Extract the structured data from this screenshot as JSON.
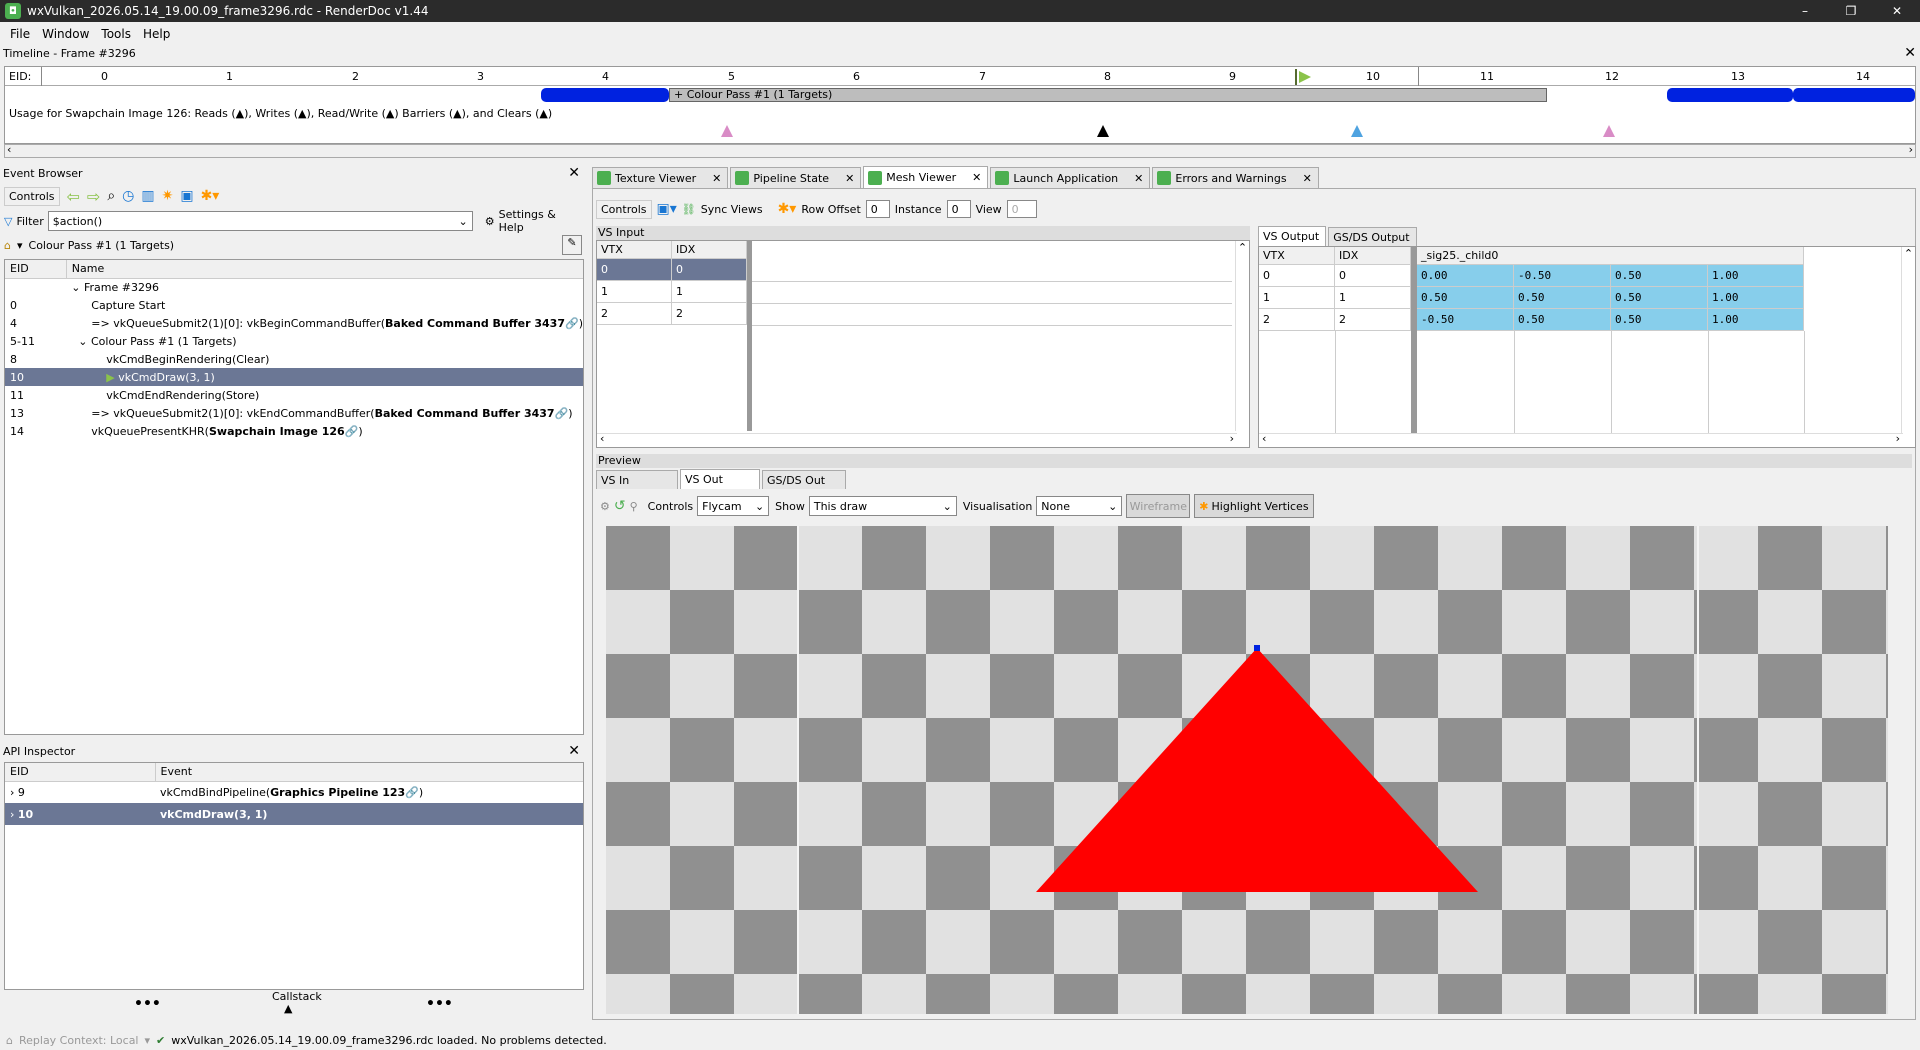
{
  "window": {
    "title": "wxVulkan_2026.05.14_19.00.09_frame3296.rdc - RenderDoc v1.44",
    "min": "–",
    "restore": "❐",
    "close": "✕"
  },
  "menu": [
    "File",
    "Window",
    "Tools",
    "Help"
  ],
  "timeline": {
    "title": "Timeline - Frame #3296",
    "eid_label": "EID:",
    "ticks": [
      "0",
      "1",
      "2",
      "3",
      "4",
      "5",
      "6",
      "7",
      "8",
      "9",
      "10",
      "11",
      "12",
      "13",
      "14"
    ],
    "pass_label": "+ Colour Pass #1 (1 Targets)",
    "usage_text": "Usage for Swapchain Image 126: Reads (▲), Writes (▲), Read/Write (▲) Barriers (▲), and Clears (▲)"
  },
  "event_browser": {
    "title": "Event Browser",
    "controls_label": "Controls",
    "filter_label": "Filter",
    "filter_value": "$action()",
    "settings_label": "Settings & Help",
    "breadcrumb": "Colour Pass #1 (1 Targets)",
    "columns": [
      "EID",
      "Name"
    ],
    "rows": [
      {
        "eid": "",
        "name": "Frame #3296",
        "indent": 0,
        "expand": "v"
      },
      {
        "eid": "0",
        "name": "Capture Start",
        "indent": 1
      },
      {
        "eid": "4",
        "name": "=> vkQueueSubmit2(1)[0]: vkBeginCommandBuffer(",
        "bold": "Baked Command Buffer 3437",
        "tail": ")",
        "indent": 1
      },
      {
        "eid": "5-11",
        "name": "Colour Pass #1 (1 Targets)",
        "indent": 1,
        "expand": "v"
      },
      {
        "eid": "8",
        "name": "vkCmdBeginRendering(Clear)",
        "indent": 2
      },
      {
        "eid": "10",
        "name": "vkCmdDraw(3, 1)",
        "indent": 2,
        "selected": true
      },
      {
        "eid": "11",
        "name": "vkCmdEndRendering(Store)",
        "indent": 2
      },
      {
        "eid": "13",
        "name": "=> vkQueueSubmit2(1)[0]: vkEndCommandBuffer(",
        "bold": "Baked Command Buffer 3437",
        "tail": ")",
        "indent": 1
      },
      {
        "eid": "14",
        "name": "vkQueuePresentKHR(",
        "bold": "Swapchain Image 126",
        "tail": ")",
        "indent": 1
      }
    ]
  },
  "api_inspector": {
    "title": "API Inspector",
    "columns": [
      "EID",
      "Event"
    ],
    "rows": [
      {
        "eid": "9",
        "event": "vkCmdBindPipeline(",
        "bold": "Graphics Pipeline 123",
        "tail": ")"
      },
      {
        "eid": "10",
        "event": "vkCmdDraw(3, 1)",
        "selected": true
      }
    ],
    "callstack": "Callstack"
  },
  "tabs": [
    "Texture Viewer",
    "Pipeline State",
    "Mesh Viewer",
    "Launch Application",
    "Errors and Warnings"
  ],
  "mesh": {
    "controls_label": "Controls",
    "sync_views": "Sync Views",
    "row_offset_label": "Row Offset",
    "row_offset": "0",
    "instance_label": "Instance",
    "instance": "0",
    "view_label": "View",
    "view": "0",
    "vs_input": {
      "title": "VS Input",
      "columns": [
        "VTX",
        "IDX"
      ],
      "rows": [
        [
          "0",
          "0"
        ],
        [
          "1",
          "1"
        ],
        [
          "2",
          "2"
        ]
      ]
    },
    "vs_output": {
      "tabs": [
        "VS Output",
        "GS/DS Output"
      ],
      "columns": [
        "VTX",
        "IDX",
        "_sig25._child0"
      ],
      "rows": [
        [
          "0",
          "0",
          "0.00",
          "-0.50",
          "0.50",
          "1.00"
        ],
        [
          "1",
          "1",
          "0.50",
          "0.50",
          "0.50",
          "1.00"
        ],
        [
          "2",
          "2",
          "-0.50",
          "0.50",
          "0.50",
          "1.00"
        ]
      ]
    },
    "preview": {
      "title": "Preview",
      "tabs": [
        "VS In",
        "VS Out",
        "GS/DS Out"
      ],
      "controls_label": "Controls",
      "controls_value": "Flycam",
      "show_label": "Show",
      "show_value": "This draw",
      "vis_label": "Visualisation",
      "vis_value": "None",
      "wireframe": "Wireframe",
      "highlight": "Highlight Vertices"
    }
  },
  "status": {
    "replay_context": "Replay Context: Local",
    "message": "wxVulkan_2026.05.14_19.00.09_frame3296.rdc loaded. No problems detected."
  },
  "colors": {
    "accent": "#6b7795",
    "blue": "#0022e0",
    "red": "#ff0000",
    "cell": "#87ceeb"
  }
}
